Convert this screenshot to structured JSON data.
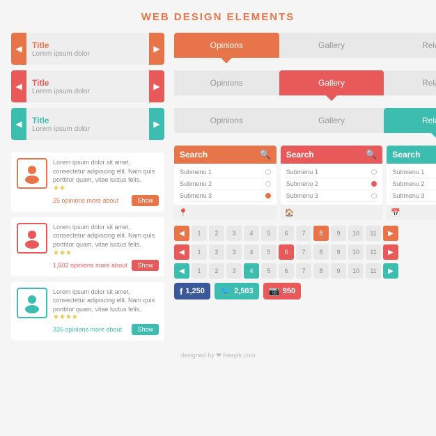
{
  "title": "WEB DESIGN ELEMENTS",
  "sliders": [
    {
      "title": "Title",
      "subtitle": "Lorem ipsum dolor",
      "color": "orange",
      "arrowColor": "orange"
    },
    {
      "title": "Title",
      "subtitle": "Lorem ipsum dolor",
      "color": "red",
      "arrowColor": "red"
    },
    {
      "title": "Title",
      "subtitle": "Lorem ipsum dolor",
      "color": "teal",
      "arrowColor": "teal"
    }
  ],
  "tabs": [
    {
      "items": [
        "Opinions",
        "Gallery",
        "Related"
      ],
      "active": 0,
      "activeClass": "active-orange"
    },
    {
      "items": [
        "Opinions",
        "Gallery",
        "Related"
      ],
      "active": 1,
      "activeClass": "active-red"
    },
    {
      "items": [
        "Opinions",
        "Gallery",
        "Related"
      ],
      "active": 2,
      "activeClass": "active-teal"
    }
  ],
  "opinions": [
    {
      "text": "Lorem ipsum dolor sit amet, consectetur adipiscing elit. Nam quis porttitor quam, vitae luctus felis.",
      "stars": "★★",
      "count": "25 opinions more about",
      "showLabel": "Show",
      "color": "orange"
    },
    {
      "text": "Lorem ipsum dolor sit amet, consectetur adipiscing elit. Nam quis porttitor quam, vitae luctus felis.",
      "stars": "★★★",
      "count": "1,502 opinions more about",
      "showLabel": "Show",
      "color": "red"
    },
    {
      "text": "Lorem ipsum dolor sit amet, consectetur adipiscing elit. Nam quis porttitor quam, vitae luctus felis.",
      "stars": "★★★★",
      "count": "335 opinions more about",
      "showLabel": "Show",
      "color": "teal"
    }
  ],
  "searchBoxes": [
    {
      "label": "Search",
      "color": "orange",
      "submenus": [
        {
          "label": "Submenu 1",
          "dot": "empty"
        },
        {
          "label": "Submenu 2",
          "dot": "empty"
        },
        {
          "label": "Submenu 3",
          "dot": "orange"
        }
      ],
      "inputType": "location"
    },
    {
      "label": "Search",
      "color": "red",
      "submenus": [
        {
          "label": "Submenu 1",
          "dot": "empty"
        },
        {
          "label": "Submenu 2",
          "dot": "red"
        },
        {
          "label": "Submenu 3",
          "dot": "empty"
        }
      ],
      "inputType": "home"
    },
    {
      "label": "Search",
      "color": "teal",
      "submenus": [
        {
          "label": "Submenu 1",
          "dot": "teal"
        },
        {
          "label": "Submenu 2",
          "dot": "empty"
        },
        {
          "label": "Submenu 3",
          "dot": "empty"
        }
      ],
      "inputType": "calendar"
    }
  ],
  "paginationRows": [
    {
      "arrowColor": "orange",
      "activeNum": "8",
      "activeClass": "active-orange",
      "nums": [
        "1",
        "2",
        "3",
        "4",
        "5",
        "6",
        "7",
        "8",
        "9",
        "10",
        "11"
      ]
    },
    {
      "arrowColor": "red",
      "activeNum": "6",
      "activeClass": "active-red",
      "nums": [
        "1",
        "2",
        "3",
        "4",
        "5",
        "6",
        "7",
        "8",
        "9",
        "10",
        "11"
      ]
    },
    {
      "arrowColor": "teal",
      "activeNum": "4",
      "activeClass": "active-teal",
      "nums": [
        "1",
        "2",
        "3",
        "4",
        "5",
        "6",
        "7",
        "8",
        "9",
        "10",
        "11"
      ]
    }
  ],
  "social": [
    {
      "platform": "facebook",
      "icon": "f",
      "count": "1,250",
      "colorClass": "fb"
    },
    {
      "platform": "twitter",
      "icon": "🐦",
      "count": "2,503",
      "colorClass": "tw"
    },
    {
      "platform": "instagram",
      "icon": "📷",
      "count": "950",
      "colorClass": "ig"
    }
  ],
  "footer": "designed by ❤ freepik.com"
}
